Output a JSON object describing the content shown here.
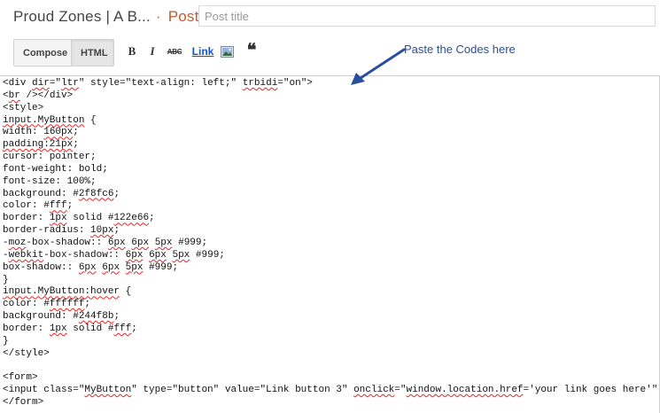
{
  "header": {
    "blog_title": "Proud Zones | A B...",
    "separator": "·",
    "post_label": "Post",
    "title_placeholder": "Post title"
  },
  "toolbar": {
    "compose_label": "Compose",
    "html_label": "HTML",
    "bold_label": "B",
    "italic_label": "I",
    "strike_label": "ABC",
    "link_label": "Link",
    "image_icon": "image-icon",
    "quote_label": "❝",
    "active_mode": "HTML"
  },
  "annotation": {
    "text": "Paste the Codes here",
    "color": "#2a4f9a"
  },
  "code_lines": [
    [
      {
        "t": "<div "
      },
      {
        "t": "dir",
        "s": 1
      },
      {
        "t": "=\""
      },
      {
        "t": "ltr",
        "s": 1
      },
      {
        "t": "\" style=\"text-align: left;\" "
      },
      {
        "t": "trbidi",
        "s": 1
      },
      {
        "t": "=\"on\">"
      }
    ],
    [
      {
        "t": "<"
      },
      {
        "t": "br",
        "s": 1
      },
      {
        "t": " /></div>"
      }
    ],
    [
      {
        "t": "<style>"
      }
    ],
    [
      {
        "t": "input.MyButton",
        "s": 1
      },
      {
        "t": " {"
      }
    ],
    [
      {
        "t": "width: "
      },
      {
        "t": "160px",
        "s": 1
      },
      {
        "t": ";"
      }
    ],
    [
      {
        "t": "padding:21px",
        "s": 1
      },
      {
        "t": ";"
      }
    ],
    [
      {
        "t": "cursor: pointer;"
      }
    ],
    [
      {
        "t": "font-weight: bold;"
      }
    ],
    [
      {
        "t": "font-size: 100%;"
      }
    ],
    [
      {
        "t": "background: #"
      },
      {
        "t": "2f8fc6",
        "s": 1
      },
      {
        "t": ";"
      }
    ],
    [
      {
        "t": "color: #"
      },
      {
        "t": "fff",
        "s": 1
      },
      {
        "t": ";"
      }
    ],
    [
      {
        "t": "border: "
      },
      {
        "t": "1px",
        "s": 1
      },
      {
        "t": " solid #"
      },
      {
        "t": "122e66",
        "s": 1
      },
      {
        "t": ";"
      }
    ],
    [
      {
        "t": "border-radius: "
      },
      {
        "t": "10px",
        "s": 1
      },
      {
        "t": ";"
      }
    ],
    [
      {
        "t": "-"
      },
      {
        "t": "moz",
        "s": 1
      },
      {
        "t": "-box-shadow:: "
      },
      {
        "t": "6px",
        "s": 1
      },
      {
        "t": " "
      },
      {
        "t": "6px",
        "s": 1
      },
      {
        "t": " "
      },
      {
        "t": "5px",
        "s": 1
      },
      {
        "t": " #999;"
      }
    ],
    [
      {
        "t": "-"
      },
      {
        "t": "webkit",
        "s": 1
      },
      {
        "t": "-box-shadow:: "
      },
      {
        "t": "6px",
        "s": 1
      },
      {
        "t": " "
      },
      {
        "t": "6px",
        "s": 1
      },
      {
        "t": " "
      },
      {
        "t": "5px",
        "s": 1
      },
      {
        "t": " #999;"
      }
    ],
    [
      {
        "t": "box-shadow:: "
      },
      {
        "t": "6px",
        "s": 1
      },
      {
        "t": " "
      },
      {
        "t": "6px",
        "s": 1
      },
      {
        "t": " "
      },
      {
        "t": "5px",
        "s": 1
      },
      {
        "t": " #999;"
      }
    ],
    [
      {
        "t": "}"
      }
    ],
    [
      {
        "t": "input.MyButton:hover",
        "s": 1
      },
      {
        "t": " {"
      }
    ],
    [
      {
        "t": "color: #"
      },
      {
        "t": "ffffff",
        "s": 1
      },
      {
        "t": ";"
      }
    ],
    [
      {
        "t": "background: #"
      },
      {
        "t": "244f8b",
        "s": 1
      },
      {
        "t": ";"
      }
    ],
    [
      {
        "t": "border: "
      },
      {
        "t": "1px",
        "s": 1
      },
      {
        "t": " solid #"
      },
      {
        "t": "fff",
        "s": 1
      },
      {
        "t": ";"
      }
    ],
    [
      {
        "t": "}"
      }
    ],
    [
      {
        "t": "</style>"
      }
    ],
    [
      {
        "t": ""
      }
    ],
    [
      {
        "t": "<form>"
      }
    ],
    [
      {
        "t": "<input class=\""
      },
      {
        "t": "MyButton",
        "s": 1
      },
      {
        "t": "\" type=\"button\" value=\"Link button 3\" "
      },
      {
        "t": "onclick",
        "s": 1
      },
      {
        "t": "=\""
      },
      {
        "t": "window.location.href",
        "s": 1
      },
      {
        "t": "='your link goes here'\" />"
      }
    ],
    [
      {
        "t": "</form>"
      }
    ]
  ]
}
